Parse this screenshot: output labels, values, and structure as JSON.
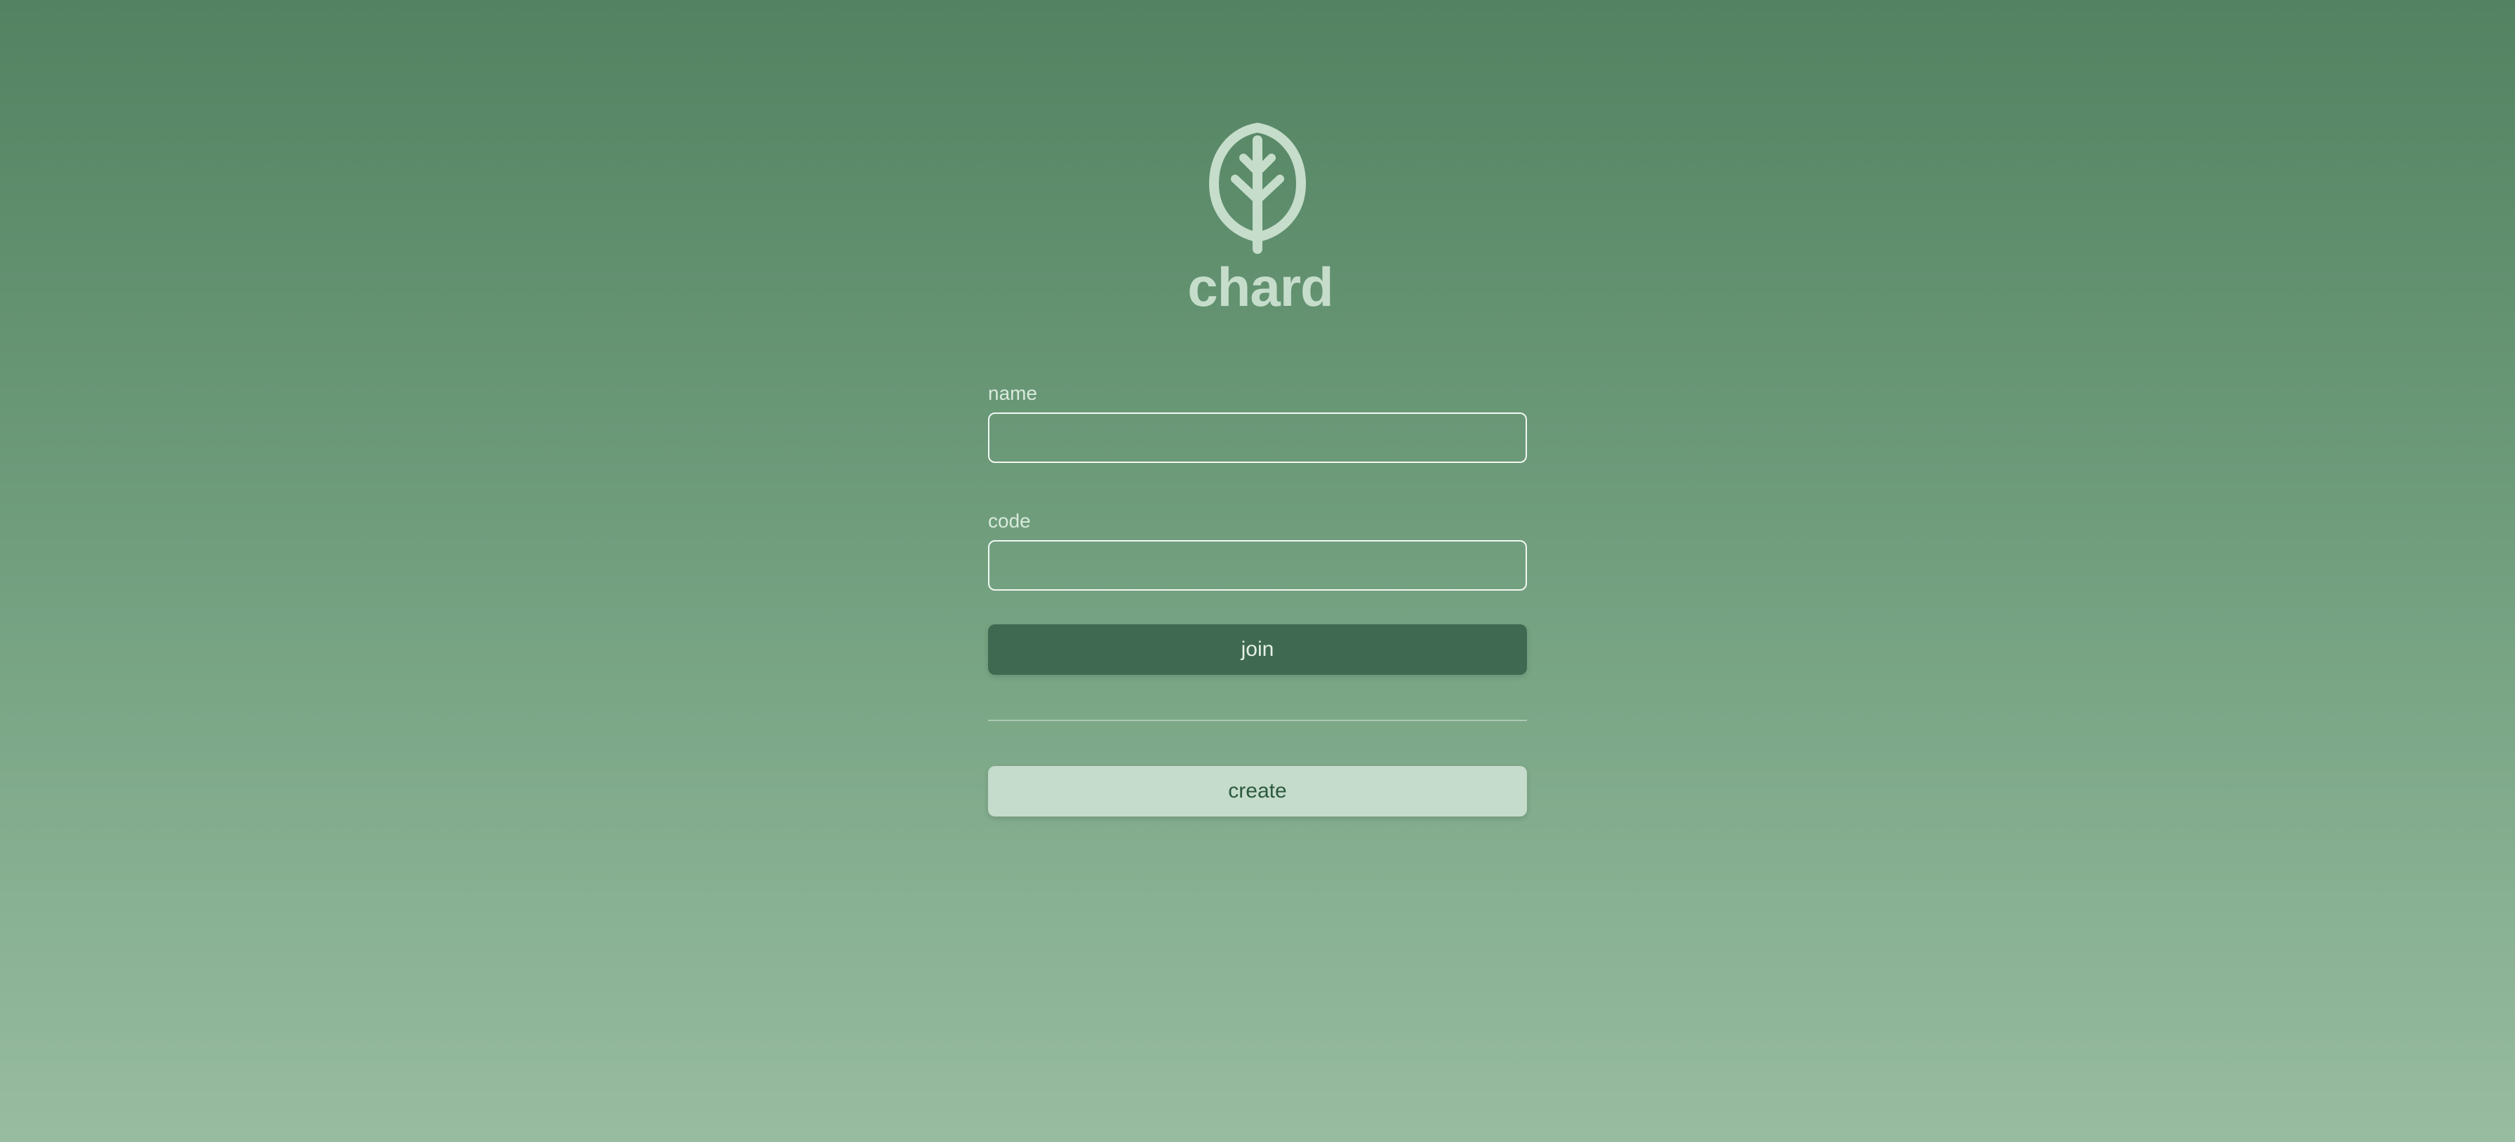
{
  "app": {
    "name": "chard",
    "logo_icon": "leaf-icon"
  },
  "form": {
    "name_label": "name",
    "name_value": "",
    "code_label": "code",
    "code_value": "",
    "join_label": "join",
    "create_label": "create"
  },
  "colors": {
    "background_top": "#528261",
    "background_bottom": "#98bca0",
    "brand_text": "#c5ddca",
    "join_button": "#3f6a51",
    "create_button": "#c5dbcb",
    "create_text": "#2c5a3d"
  }
}
